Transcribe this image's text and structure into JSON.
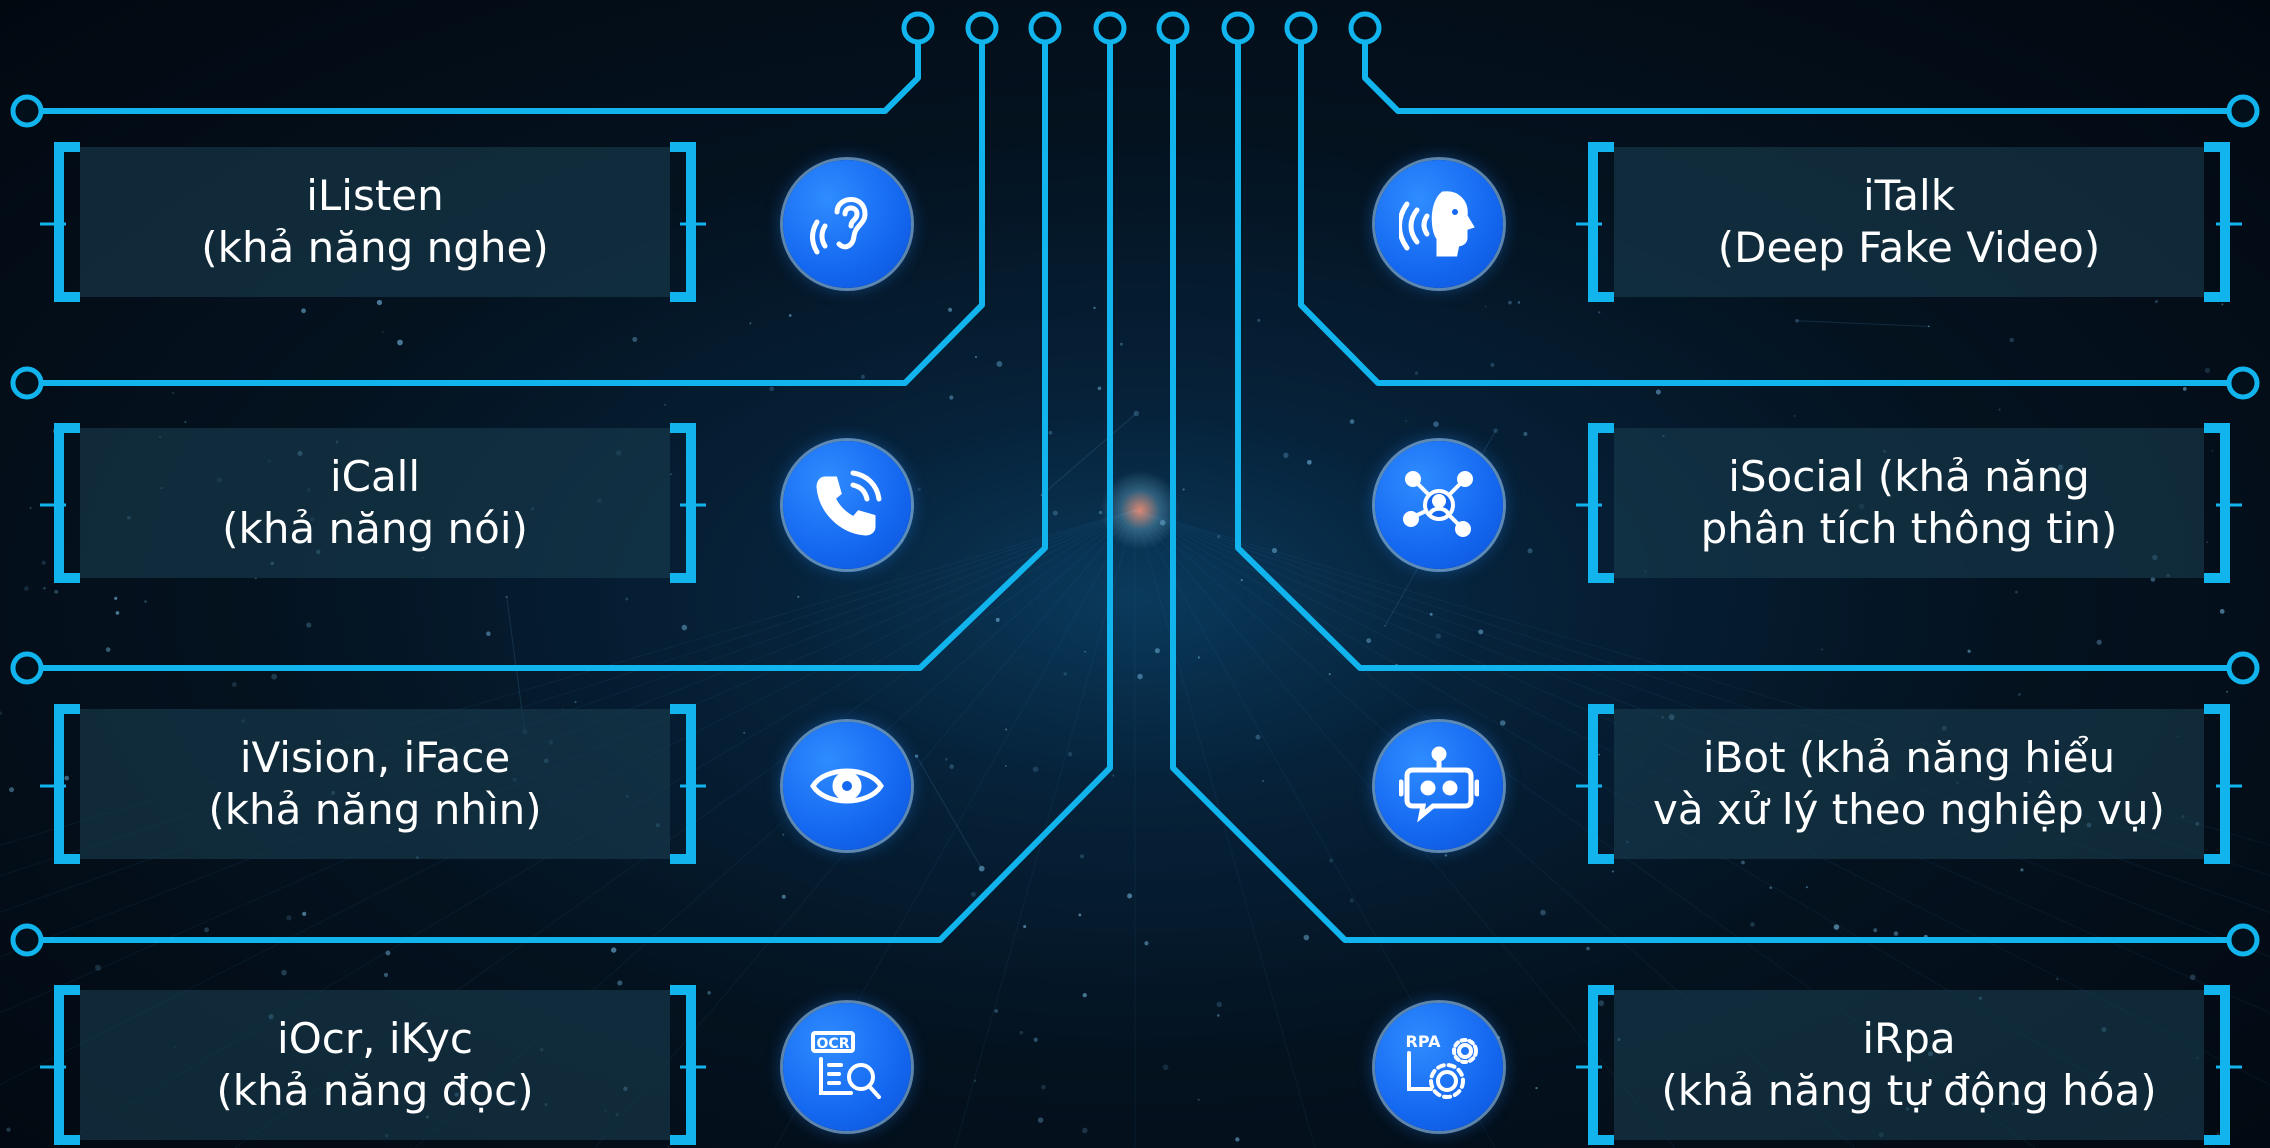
{
  "accent_color": "#12b4ee",
  "icon_color": "#1467f0",
  "background_color": "#04121f",
  "modules": [
    {
      "line1": "iListen",
      "line2": "(khả năng nghe)",
      "icon": "ear-sound-icon"
    },
    {
      "line1": "iCall",
      "line2": "(khả năng nói)",
      "icon": "phone-call-icon"
    },
    {
      "line1": "iVision, iFace",
      "line2": "(khả năng nhìn)",
      "icon": "eye-icon"
    },
    {
      "line1": "iOcr, iKyc",
      "line2": "(khả năng đọc)",
      "icon": "ocr-document-icon"
    },
    {
      "line1": "iTalk",
      "line2": "(Deep Fake Video)",
      "icon": "speaking-head-icon"
    },
    {
      "line1": "iSocial (khả năng",
      "line2": "phân tích thông tin)",
      "icon": "social-network-icon"
    },
    {
      "line1": "iBot (khả năng hiểu",
      "line2": "và xử lý theo nghiệp vụ)",
      "icon": "robot-chat-icon"
    },
    {
      "line1": "iRpa",
      "line2": "(khả năng tự động hóa)",
      "icon": "rpa-gears-icon"
    }
  ],
  "icon_text": {
    "ocr": "OCR",
    "rpa": "RPA"
  }
}
